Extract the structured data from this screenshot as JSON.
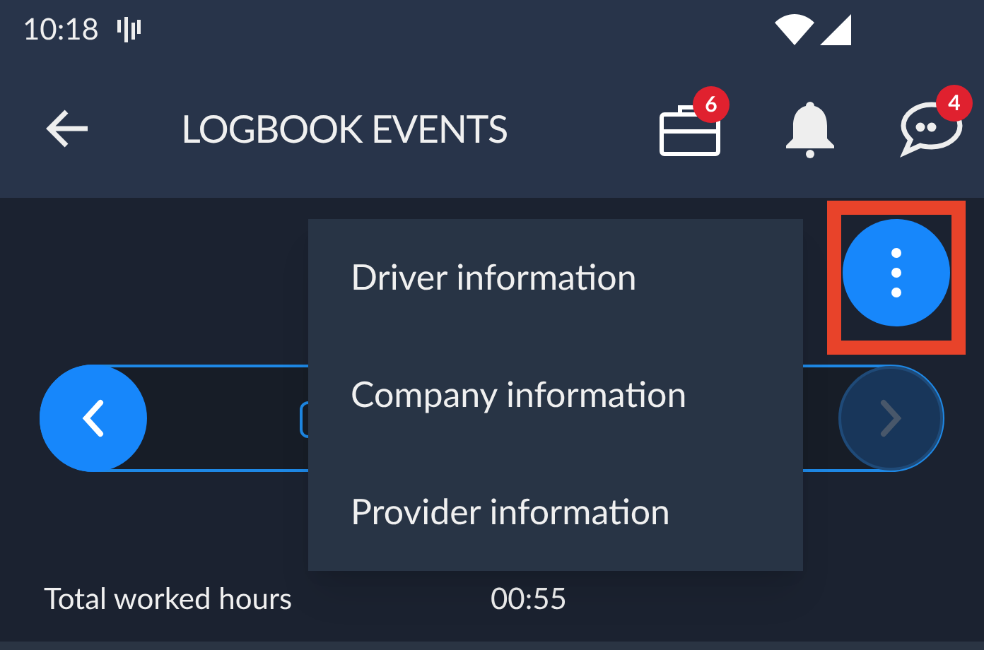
{
  "status_bar": {
    "time": "10:18"
  },
  "app_bar": {
    "title": "LOGBOOK EVENTS",
    "actions": [
      {
        "kind": "briefcase",
        "badge": "6"
      },
      {
        "kind": "bell"
      },
      {
        "kind": "chat",
        "badge": "4"
      }
    ]
  },
  "date_nav": {
    "previous_disabled": false,
    "next_disabled": true
  },
  "menu": {
    "items": [
      {
        "label": "Driver information"
      },
      {
        "label": "Company information"
      },
      {
        "label": "Provider information"
      }
    ]
  },
  "summary": {
    "label": "Total worked hours",
    "value": "00:55"
  }
}
